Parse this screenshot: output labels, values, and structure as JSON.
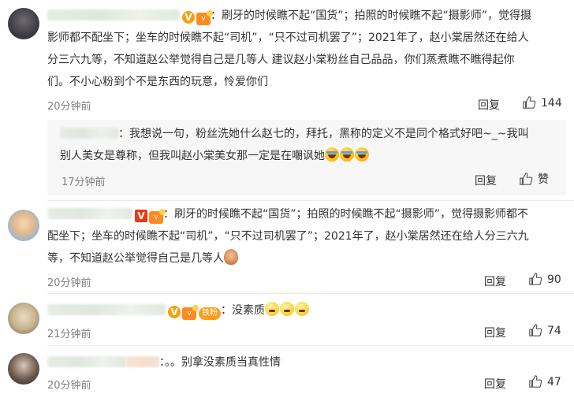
{
  "comments": [
    {
      "text_lines": [
        "：刷牙的时候瞧不起“国货”；拍照的时候瞧不起“摄影师”，觉得摄",
        "影师都不配坐下；坐车的时候瞧不起“司机”，“只不过司机罢了”；2021年了，赵小棠居然还在给人",
        "分三六九等，不知道赵公举觉得自己是几等人 建议赵小棠粉丝自己品品，你们蒸煮瞧不瞧得起你",
        "们。不小心粉到个不是东西的玩意，怜爱你们"
      ],
      "time": "20分钟前",
      "reply_label": "回复",
      "like_count": "144"
    },
    {
      "text_lines": [
        "：我想说一句，粉丝洗她什么赵七的，拜托，黑称的定义不是同个格式好吧~_~我叫",
        "别人美女是尊称，但我叫赵小棠美女那一定是在嘲讽她"
      ],
      "time": "17分钟前",
      "reply_label": "回复",
      "like_label": "赞"
    },
    {
      "text_lines": [
        "：刷牙的时候瞧不起“国货”；拍照的时候瞧不起“摄影师”，觉得摄影师都不",
        "配坐下；坐车的时候瞧不起“司机”，“只不过司机罢了”；2021年了，赵小棠居然还在给人分三六九",
        "等，不知道赵公举觉得自己是几等人"
      ],
      "time": "20分钟前",
      "reply_label": "回复",
      "like_count": "90"
    },
    {
      "fan_badge": "铁粉",
      "text_lines": [
        "：没素质"
      ],
      "time": "21分钟前",
      "reply_label": "回复",
      "like_count": "74"
    },
    {
      "text_lines": [
        "：。。别拿没素质当真性情"
      ],
      "time": "20分钟前",
      "reply_label": "回复",
      "like_count": "47"
    }
  ],
  "icons": {
    "like": "thumbs-up-icon",
    "verified": "v-badge-icon",
    "vip": "vip-badge-icon"
  },
  "colors": {
    "meta_gray": "#808080",
    "badge_orange": "#f7a10c",
    "badge_red": "#e8391b",
    "subbox_bg": "#f7f7f7"
  }
}
